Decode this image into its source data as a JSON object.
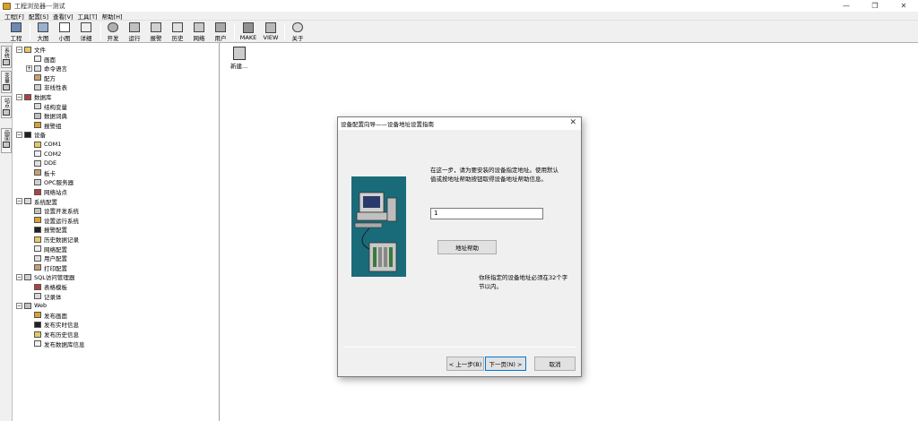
{
  "window": {
    "title": "工程浏览器---测试",
    "min": "—",
    "restore": "❐",
    "close": "✕"
  },
  "menu": [
    "工程[F]",
    "配置[S]",
    "查看[V]",
    "工具[T]",
    "帮助[H]"
  ],
  "toolbar": [
    {
      "label": "工程",
      "icon": "project-icon"
    },
    {
      "label": "大图",
      "icon": "large-icons-icon"
    },
    {
      "label": "小图",
      "icon": "small-icons-icon"
    },
    {
      "label": "详细",
      "icon": "details-icon"
    },
    {
      "label": "开发",
      "icon": "develop-icon"
    },
    {
      "label": "运行",
      "icon": "run-icon"
    },
    {
      "label": "报警",
      "icon": "alarm-icon"
    },
    {
      "label": "历史",
      "icon": "history-icon"
    },
    {
      "label": "网络",
      "icon": "network-icon"
    },
    {
      "label": "用户",
      "icon": "user-icon"
    },
    {
      "label": "MAKE",
      "icon": "make-icon"
    },
    {
      "label": "VIEW",
      "icon": "view-icon"
    },
    {
      "label": "关于",
      "icon": "about-icon"
    }
  ],
  "vtabs": [
    "系统",
    "变量",
    "站点",
    "画面"
  ],
  "tree": [
    {
      "label": "文件",
      "level": 0,
      "exp": "−"
    },
    {
      "label": "画面",
      "level": 1
    },
    {
      "label": "命令语言",
      "level": 1,
      "exp": "+"
    },
    {
      "label": "配方",
      "level": 1
    },
    {
      "label": "非线性表",
      "level": 1
    },
    {
      "label": "数据库",
      "level": 0,
      "exp": "−"
    },
    {
      "label": "结构变量",
      "level": 1
    },
    {
      "label": "数据词典",
      "level": 1
    },
    {
      "label": "报警组",
      "level": 1
    },
    {
      "label": "设备",
      "level": 0,
      "exp": "−"
    },
    {
      "label": "COM1",
      "level": 1
    },
    {
      "label": "COM2",
      "level": 1
    },
    {
      "label": "DDE",
      "level": 1
    },
    {
      "label": "板卡",
      "level": 1
    },
    {
      "label": "OPC服务器",
      "level": 1
    },
    {
      "label": "网络站点",
      "level": 1
    },
    {
      "label": "系统配置",
      "level": 0,
      "exp": "−"
    },
    {
      "label": "设置开发系统",
      "level": 1
    },
    {
      "label": "设置运行系统",
      "level": 1
    },
    {
      "label": "报警配置",
      "level": 1
    },
    {
      "label": "历史数据记录",
      "level": 1
    },
    {
      "label": "网络配置",
      "level": 1
    },
    {
      "label": "用户配置",
      "level": 1
    },
    {
      "label": "打印配置",
      "level": 1
    },
    {
      "label": "SQL访问管理器",
      "level": 0,
      "exp": "−"
    },
    {
      "label": "表格模板",
      "level": 1
    },
    {
      "label": "记录体",
      "level": 1
    },
    {
      "label": "Web",
      "level": 0,
      "exp": "−"
    },
    {
      "label": "发布画面",
      "level": 1
    },
    {
      "label": "发布实时信息",
      "level": 1
    },
    {
      "label": "发布历史信息",
      "level": 1
    },
    {
      "label": "发布数据库信息",
      "level": 1
    }
  ],
  "rightpane": {
    "new_label": "新建..."
  },
  "dialog": {
    "title": "设备配置向导——设备地址设置指南",
    "close": "✕",
    "instruction": "在这一步，请为要安装的设备指定地址。使用默认值或按地址帮助按钮取得设备地址帮助信息。",
    "address_value": "1",
    "help_button": "地址帮助",
    "hint": "你所指定的设备地址必须在32个字节以内。",
    "back_button": "< 上一步(B)",
    "next_button": "下一页(N) >",
    "cancel_button": "取消"
  }
}
